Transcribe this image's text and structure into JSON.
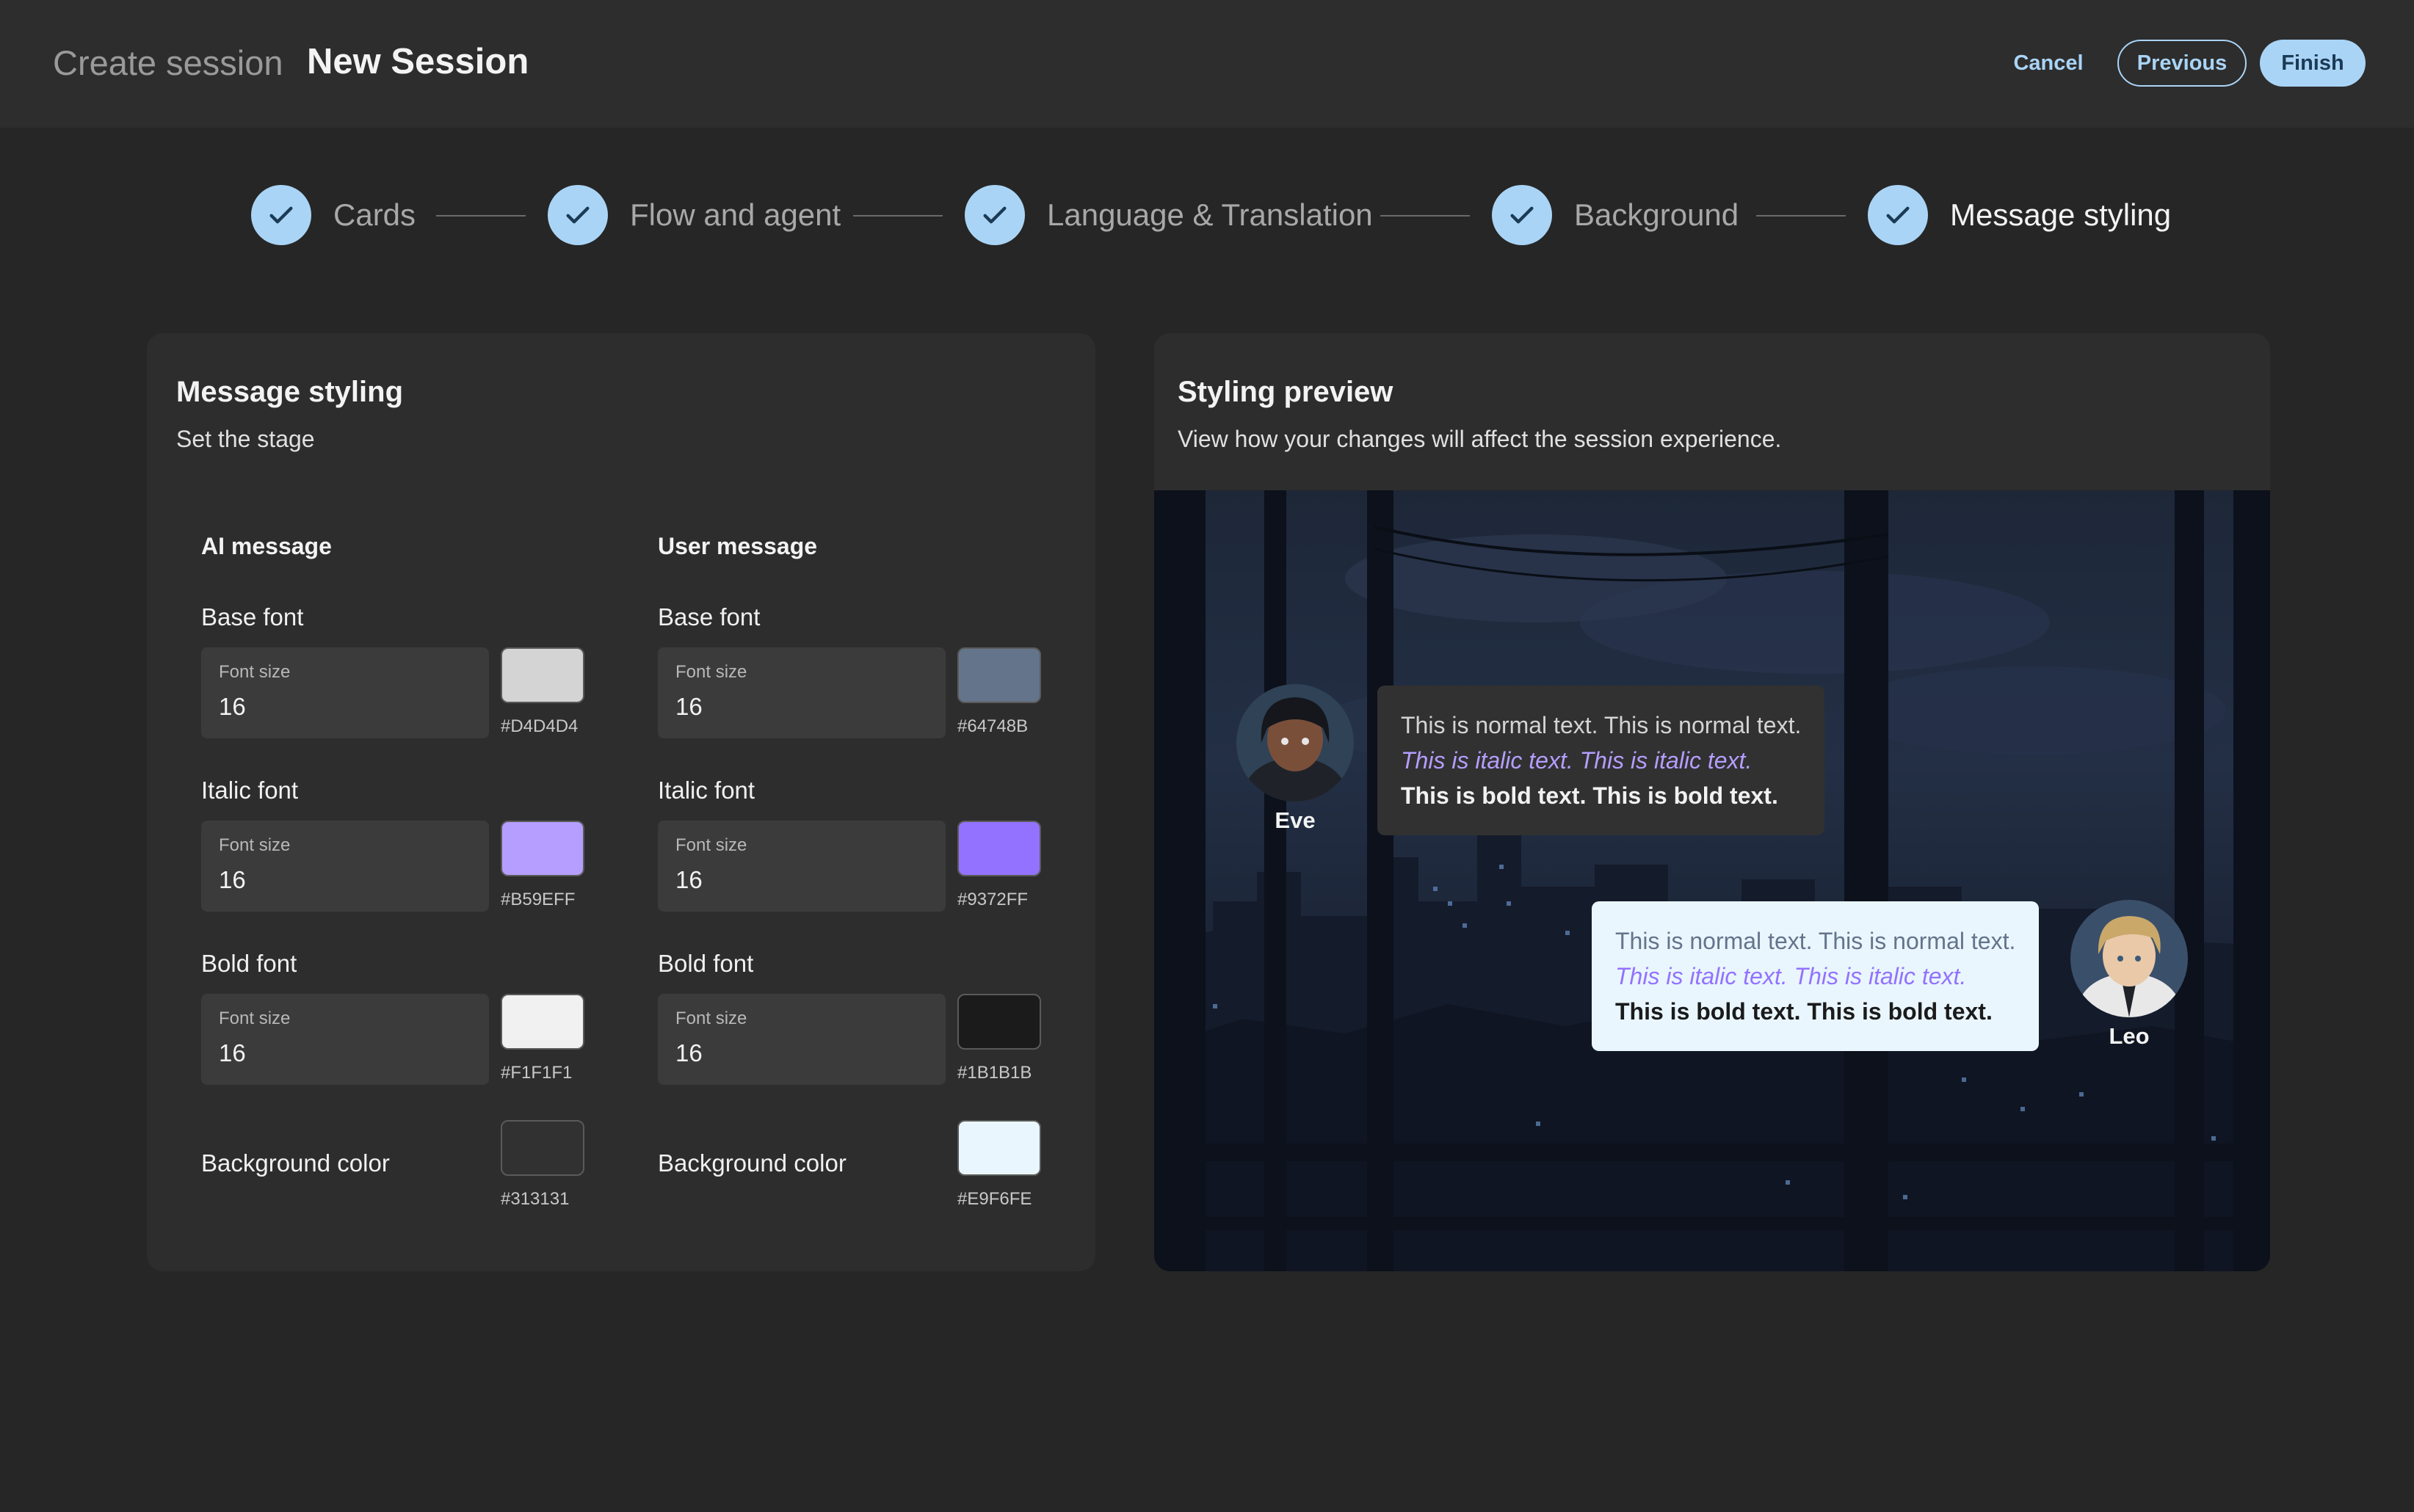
{
  "header": {
    "breadcrumb": "Create session",
    "title": "New Session",
    "cancel_label": "Cancel",
    "previous_label": "Previous",
    "finish_label": "Finish"
  },
  "stepper": {
    "steps": [
      {
        "label": "Cards",
        "completed": true
      },
      {
        "label": "Flow and agent",
        "completed": true
      },
      {
        "label": "Language & Translation",
        "completed": true
      },
      {
        "label": "Background",
        "completed": true
      },
      {
        "label": "Message styling",
        "completed": true,
        "active": true
      }
    ]
  },
  "styling": {
    "title": "Message styling",
    "subtitle": "Set the stage",
    "font_size_label": "Font size",
    "ai": {
      "heading": "AI message",
      "base": {
        "label": "Base font",
        "size": "16",
        "color": "#D4D4D4"
      },
      "italic": {
        "label": "Italic font",
        "size": "16",
        "color": "#B59EFF"
      },
      "bold": {
        "label": "Bold font",
        "size": "16",
        "color": "#F1F1F1"
      },
      "background": {
        "label": "Background color",
        "color": "#313131"
      }
    },
    "user": {
      "heading": "User message",
      "base": {
        "label": "Base font",
        "size": "16",
        "color": "#64748B"
      },
      "italic": {
        "label": "Italic font",
        "size": "16",
        "color": "#9372FF"
      },
      "bold": {
        "label": "Bold font",
        "size": "16",
        "color": "#1B1B1B"
      },
      "background": {
        "label": "Background color",
        "color": "#E9F6FE"
      }
    }
  },
  "preview": {
    "title": "Styling preview",
    "subtitle": "View how your changes will affect the session experience.",
    "ai_name": "Eve",
    "user_name": "Leo",
    "normal_text": "This is normal text. This is normal text.",
    "italic_text": "This is italic text. This is italic text.",
    "bold_text": "This is bold text. This is bold text."
  },
  "colors": {
    "accent": "#A9D4F6",
    "page_bg": "#262626",
    "panel_bg": "#2D2D2D",
    "input_bg": "#3B3B3B"
  }
}
